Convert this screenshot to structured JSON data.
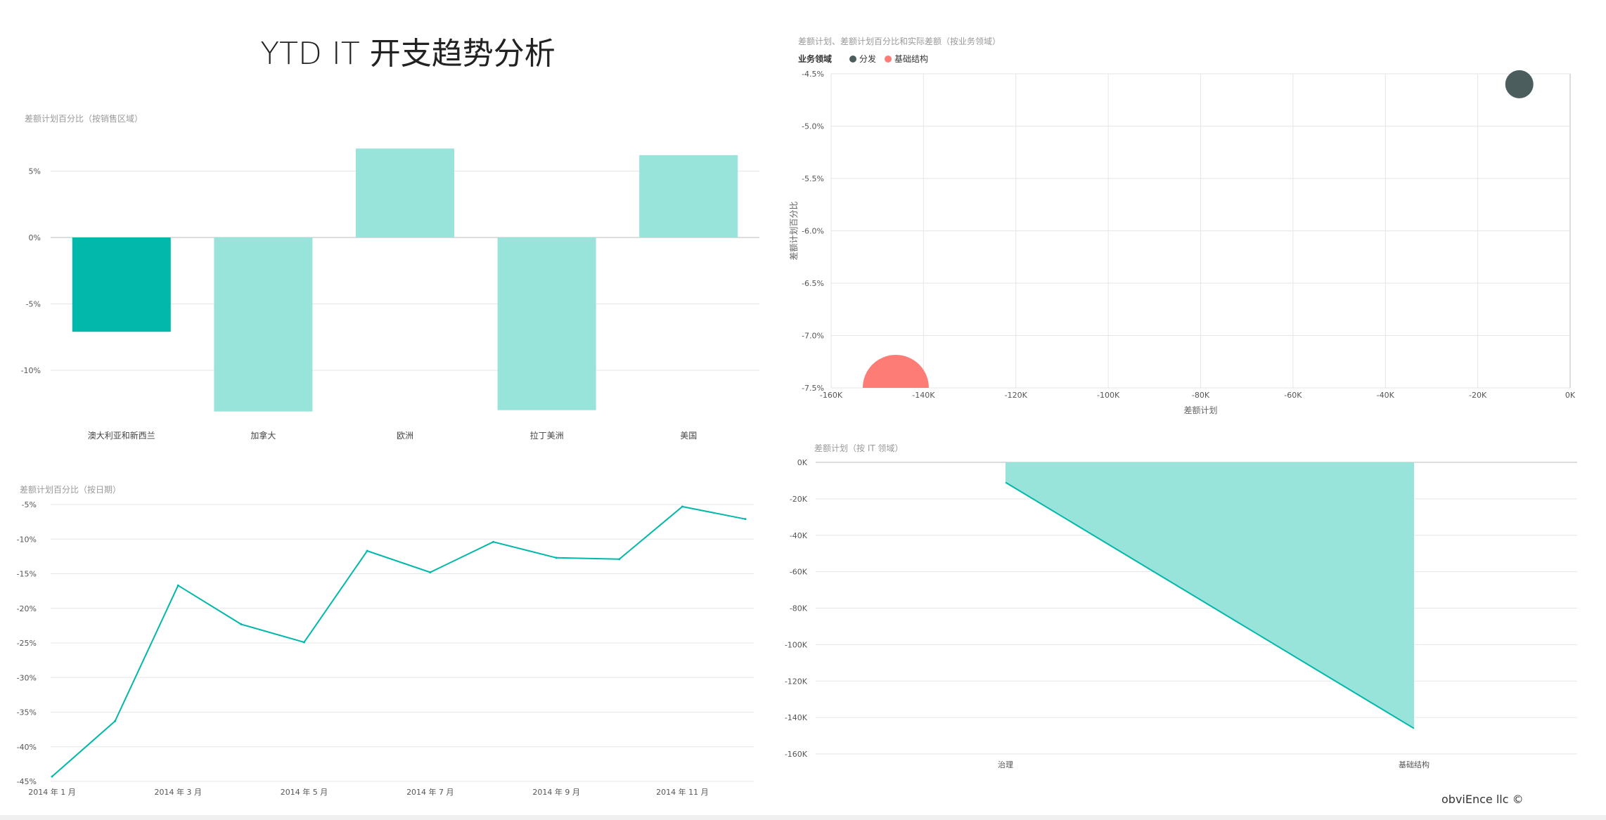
{
  "main_title": "YTD IT 开支趋势分析",
  "footer": "obviEnce llc ©",
  "colors": {
    "teal": "#01B8AA",
    "teal_light": "#98E3DA",
    "dark": "#4C5D5D",
    "red": "#FD7C76",
    "grid": "#e6e6e6"
  },
  "chart_data": [
    {
      "type": "bar",
      "title": "差额计划百分比（按销售区域）",
      "categories": [
        "澳大利亚和新西兰",
        "加拿大",
        "欧洲",
        "拉丁美洲",
        "美国"
      ],
      "values": [
        -7.1,
        -13.1,
        6.7,
        -13.0,
        6.2
      ],
      "highlighted": [
        true,
        false,
        false,
        false,
        false
      ],
      "ylim": [
        -13.5,
        7.5
      ],
      "yticks": [
        5,
        0,
        -5,
        -10
      ],
      "ytick_labels": [
        "5%",
        "0%",
        "-5%",
        "-10%"
      ],
      "grid": true
    },
    {
      "type": "line",
      "title": "差额计划百分比（按日期）",
      "x": [
        "2014-01",
        "2014-02",
        "2014-03",
        "2014-04",
        "2014-05",
        "2014-06",
        "2014-07",
        "2014-08",
        "2014-09",
        "2014-10",
        "2014-11",
        "2014-12"
      ],
      "values": [
        -44.3,
        -36.3,
        -16.7,
        -22.3,
        -24.9,
        -11.7,
        -14.8,
        -10.4,
        -12.7,
        -12.9,
        -5.3,
        -7.1
      ],
      "xtick_labels": [
        "2014 年 1 月",
        "2014 年 3 月",
        "2014 年 5 月",
        "2014 年 7 月",
        "2014 年 9 月",
        "2014 年 11 月"
      ],
      "ylim": [
        -45,
        -5
      ],
      "yticks": [
        -5,
        -10,
        -15,
        -20,
        -25,
        -30,
        -35,
        -40,
        -45
      ],
      "ytick_labels": [
        "-5%",
        "-10%",
        "-15%",
        "-20%",
        "-25%",
        "-30%",
        "-35%",
        "-40%",
        "-45%"
      ],
      "grid": true
    },
    {
      "type": "scatter",
      "title": "差额计划、差额计划百分比和实际差额（按业务领域）",
      "legend_title": "业务领域",
      "legend_position": "top-left",
      "xlabel": "差额计划",
      "ylabel": "差额计划百分比",
      "series": [
        {
          "name": "分发",
          "x": -11,
          "y": -4.6,
          "size": "small"
        },
        {
          "name": "基础结构",
          "x": -146,
          "y": -7.5,
          "size": "large"
        }
      ],
      "xlim": [
        -160,
        0
      ],
      "ylim": [
        -7.5,
        -4.5
      ],
      "xtick_labels": [
        "-160K",
        "-140K",
        "-120K",
        "-100K",
        "-80K",
        "-60K",
        "-40K",
        "-20K",
        "0K"
      ],
      "ytick_labels": [
        "-4.5%",
        "-5.0%",
        "-5.5%",
        "-6.0%",
        "-6.5%",
        "-7.0%",
        "-7.5%"
      ],
      "grid": true
    },
    {
      "type": "area",
      "title": "差额计划（按 IT 领域）",
      "categories": [
        "治理",
        "基础结构"
      ],
      "values": [
        -11,
        -146
      ],
      "ylim": [
        -160,
        0
      ],
      "ytick_labels": [
        "0K",
        "-20K",
        "-40K",
        "-60K",
        "-80K",
        "-100K",
        "-120K",
        "-140K",
        "-160K"
      ],
      "grid": true
    }
  ]
}
